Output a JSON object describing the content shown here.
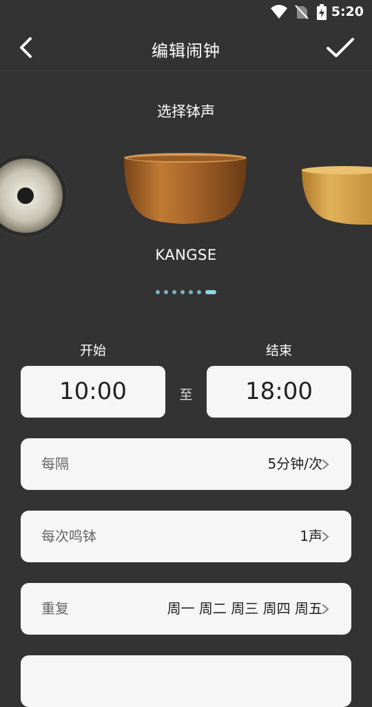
{
  "status_bar": {
    "time": "5:20"
  },
  "header": {
    "title": "编辑闹钟"
  },
  "picker": {
    "title": "选择钵声",
    "selected_name": "KANGSE",
    "page_count": 7,
    "active_index": 6
  },
  "schedule": {
    "start_label": "开始",
    "start_value": "10:00",
    "end_label": "结束",
    "end_value": "18:00",
    "to_label": "至"
  },
  "rows": [
    {
      "label": "每隔",
      "value": "5分钟/次"
    },
    {
      "label": "每次鸣钵",
      "value": "1声"
    },
    {
      "label": "重复",
      "value": "周一 周二 周三 周四 周五"
    }
  ],
  "colors": {
    "background": "#333333",
    "card": "#f6f6f6",
    "dot": "#79b3bd",
    "dot_active": "#8fd6e1"
  },
  "icons": [
    "wifi-icon",
    "no-sim-icon",
    "battery-charging-icon",
    "back-arrow-icon",
    "checkmark-icon",
    "chevron-right-icon"
  ]
}
